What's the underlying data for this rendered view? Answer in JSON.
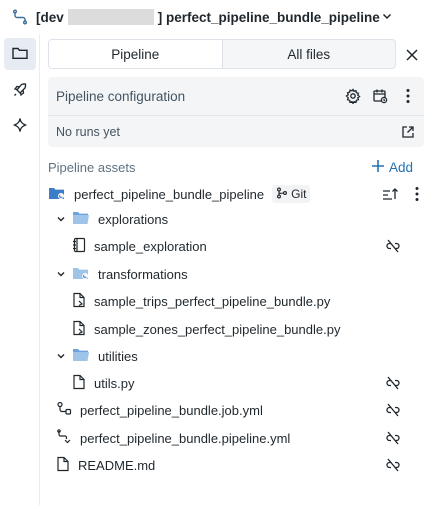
{
  "header": {
    "title_prefix": "[dev",
    "title_suffix": "] perfect_pipeline_bundle_pipeline"
  },
  "rail": {
    "items": [
      {
        "name": "folder",
        "icon": "folder-icon"
      },
      {
        "name": "rocket",
        "icon": "rocket-icon"
      },
      {
        "name": "assistant",
        "icon": "sparkle-icon"
      }
    ]
  },
  "tabs": [
    {
      "label": "Pipeline",
      "active": true
    },
    {
      "label": "All files",
      "active": false
    }
  ],
  "config": {
    "title": "Pipeline configuration",
    "status": "No runs yet"
  },
  "assets": {
    "label": "Pipeline assets",
    "add_label": "Add"
  },
  "tree": {
    "root": {
      "label": "perfect_pipeline_bundle_pipeline",
      "badge": "Git"
    },
    "explorations": {
      "label": "explorations"
    },
    "sample_exploration": {
      "label": "sample_exploration"
    },
    "transformations": {
      "label": "transformations"
    },
    "sample_trips": {
      "label": "sample_trips_perfect_pipeline_bundle.py"
    },
    "sample_zones": {
      "label": "sample_zones_perfect_pipeline_bundle.py"
    },
    "utilities": {
      "label": "utilities"
    },
    "utils": {
      "label": "utils.py"
    },
    "job_yml": {
      "label": "perfect_pipeline_bundle.job.yml"
    },
    "pipeline_yml": {
      "label": "perfect_pipeline_bundle.pipeline.yml"
    },
    "readme": {
      "label": "README.md"
    }
  },
  "colors": {
    "accent": "#2272b4",
    "folder": "#3b7dc9",
    "text": "#1f272d",
    "muted": "#5f7281"
  }
}
